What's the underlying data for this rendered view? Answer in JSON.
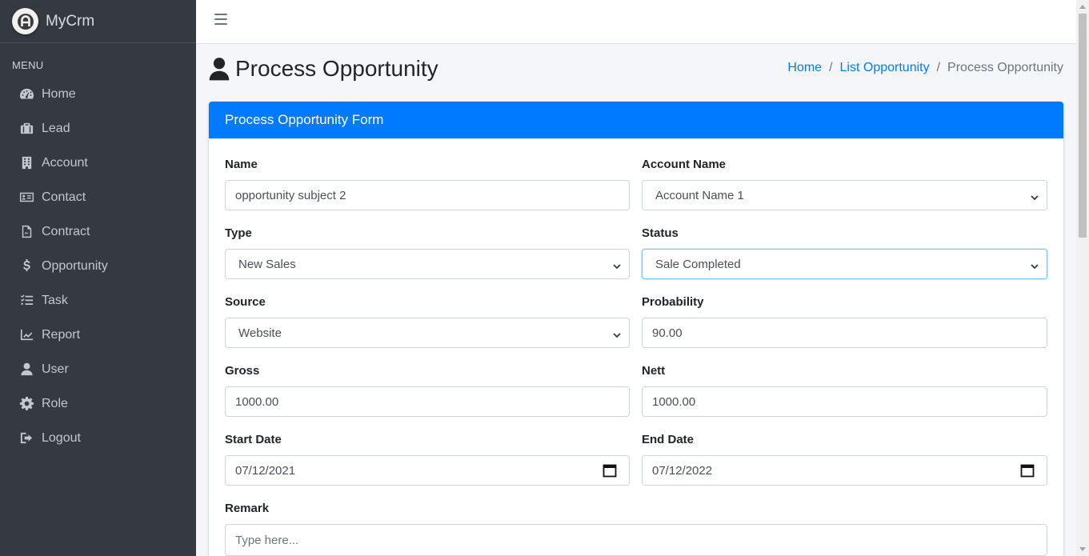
{
  "app": {
    "brand": "MyCrm"
  },
  "sidebar": {
    "menu_header": "MENU",
    "items": [
      {
        "label": "Home",
        "icon": "dashboard-icon"
      },
      {
        "label": "Lead",
        "icon": "briefcase-icon"
      },
      {
        "label": "Account",
        "icon": "building-icon"
      },
      {
        "label": "Contact",
        "icon": "id-card-icon"
      },
      {
        "label": "Contract",
        "icon": "file-signature-icon"
      },
      {
        "label": "Opportunity",
        "icon": "dollar-icon"
      },
      {
        "label": "Task",
        "icon": "tasks-icon"
      },
      {
        "label": "Report",
        "icon": "chart-line-icon"
      },
      {
        "label": "User",
        "icon": "user-icon"
      },
      {
        "label": "Role",
        "icon": "gear-icon"
      },
      {
        "label": "Logout",
        "icon": "logout-icon"
      }
    ]
  },
  "header": {
    "title": "Process Opportunity",
    "breadcrumb": {
      "home": "Home",
      "list": "List Opportunity",
      "current": "Process Opportunity",
      "separator": "/"
    }
  },
  "form": {
    "title": "Process Opportunity Form",
    "name": {
      "label": "Name",
      "value": "opportunity subject 2"
    },
    "account_name": {
      "label": "Account Name",
      "value": "Account Name 1"
    },
    "type": {
      "label": "Type",
      "value": "New Sales"
    },
    "status": {
      "label": "Status",
      "value": "Sale Completed"
    },
    "source": {
      "label": "Source",
      "value": "Website"
    },
    "probability": {
      "label": "Probability",
      "value": "90.00"
    },
    "gross": {
      "label": "Gross",
      "value": "1000.00"
    },
    "nett": {
      "label": "Nett",
      "value": "1000.00"
    },
    "start_date": {
      "label": "Start Date",
      "value": "07/12/2021"
    },
    "end_date": {
      "label": "End Date",
      "value": "07/12/2022"
    },
    "remark": {
      "label": "Remark",
      "placeholder": "Type here..."
    }
  },
  "colors": {
    "sidebar_bg": "#343a40",
    "primary": "#007bff",
    "content_bg": "#f4f6f9"
  }
}
